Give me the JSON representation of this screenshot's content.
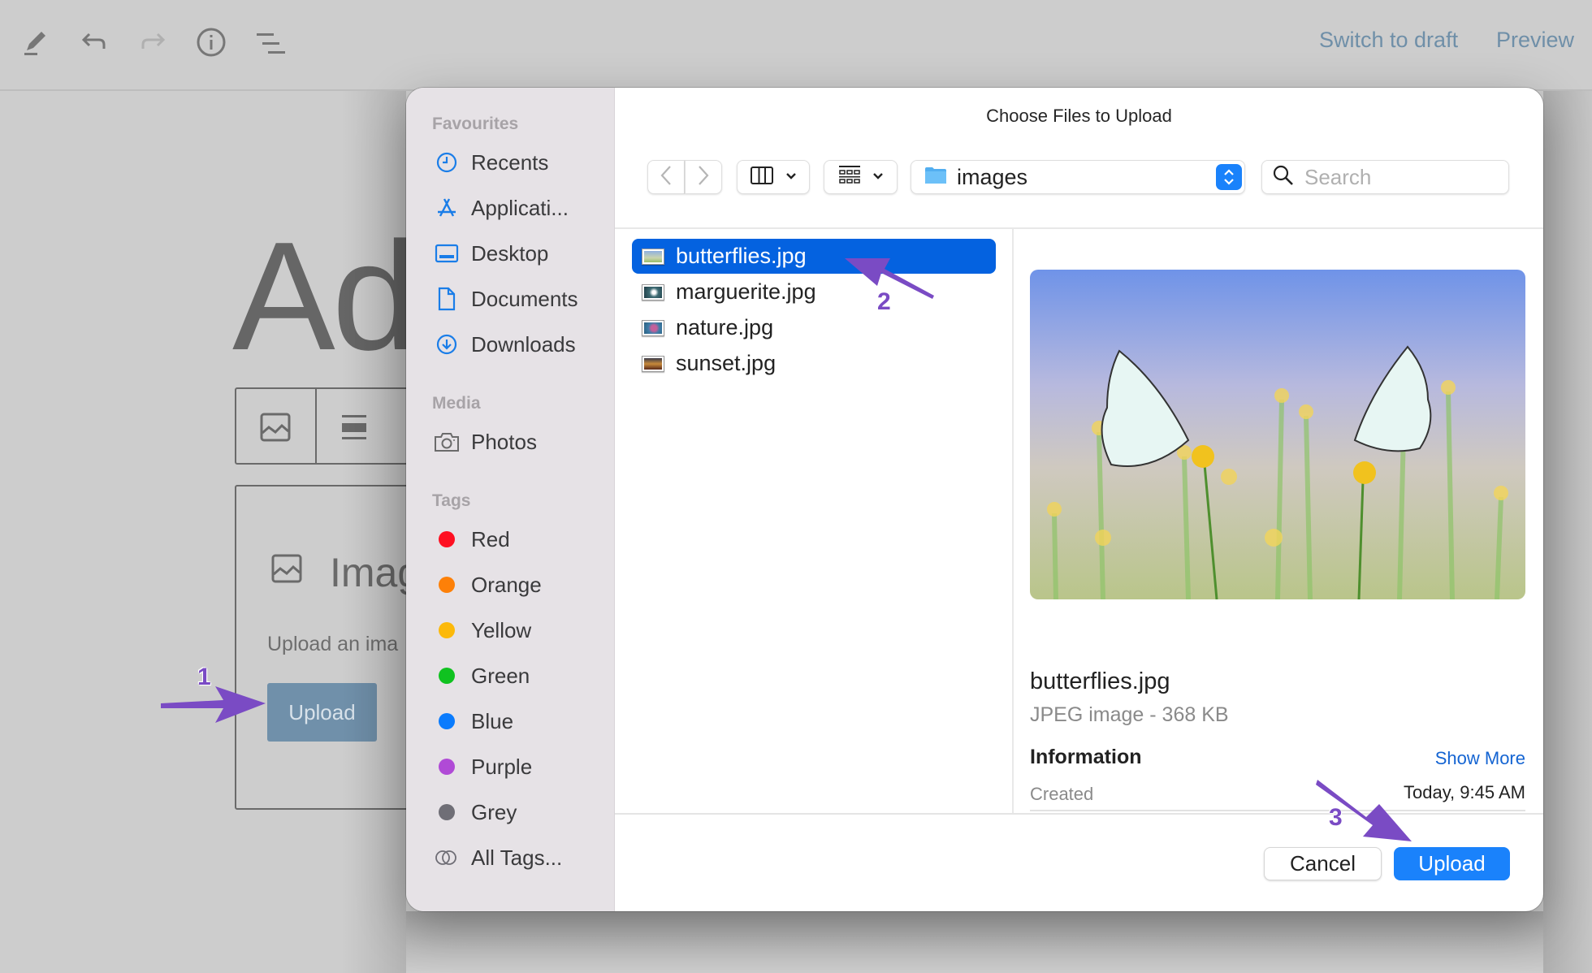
{
  "editor": {
    "toolbar_icons": [
      "pencil-icon",
      "undo-icon",
      "redo-icon",
      "info-icon",
      "list-view-icon"
    ],
    "switch_to_draft": "Switch to draft",
    "preview": "Preview",
    "title_partial": "Ad",
    "image_block_label": "Imag",
    "image_block_desc": "Upload an ima",
    "upload_button": "Upload"
  },
  "dialog": {
    "title": "Choose Files to Upload",
    "sidebar": {
      "favourites_header": "Favourites",
      "favourites": [
        {
          "label": "Recents",
          "icon": "clock-icon"
        },
        {
          "label": "Applicati...",
          "icon": "applications-icon"
        },
        {
          "label": "Desktop",
          "icon": "desktop-icon"
        },
        {
          "label": "Documents",
          "icon": "document-icon"
        },
        {
          "label": "Downloads",
          "icon": "download-icon"
        }
      ],
      "media_header": "Media",
      "media": [
        {
          "label": "Photos",
          "icon": "camera-icon"
        }
      ],
      "tags_header": "Tags",
      "tags": [
        {
          "label": "Red",
          "color": "#fe0f21"
        },
        {
          "label": "Orange",
          "color": "#fd8008"
        },
        {
          "label": "Yellow",
          "color": "#fcb90a"
        },
        {
          "label": "Green",
          "color": "#10c220"
        },
        {
          "label": "Blue",
          "color": "#0a7bfd"
        },
        {
          "label": "Purple",
          "color": "#b04ad6"
        },
        {
          "label": "Grey",
          "color": "#6f6e76"
        }
      ],
      "all_tags": "All Tags..."
    },
    "toolbar": {
      "location": "images",
      "search_placeholder": "Search"
    },
    "files": [
      {
        "name": "butterflies.jpg",
        "selected": true
      },
      {
        "name": "marguerite.jpg",
        "selected": false
      },
      {
        "name": "nature.jpg",
        "selected": false
      },
      {
        "name": "sunset.jpg",
        "selected": false
      }
    ],
    "preview": {
      "name": "butterflies.jpg",
      "kind": "JPEG image - 368 KB",
      "info_header": "Information",
      "show_more": "Show More",
      "created_label": "Created",
      "created_value": "Today, 9:45 AM"
    },
    "buttons": {
      "cancel": "Cancel",
      "upload": "Upload"
    }
  },
  "annotations": [
    {
      "number": "1",
      "target": "background upload button"
    },
    {
      "number": "2",
      "target": "butterflies.jpg"
    },
    {
      "number": "3",
      "target": "dialog upload button"
    }
  ],
  "colors": {
    "accent": "#1a82fb",
    "selection": "#0462e0",
    "annotation": "#7a4bc4",
    "link": "#1464d2"
  }
}
